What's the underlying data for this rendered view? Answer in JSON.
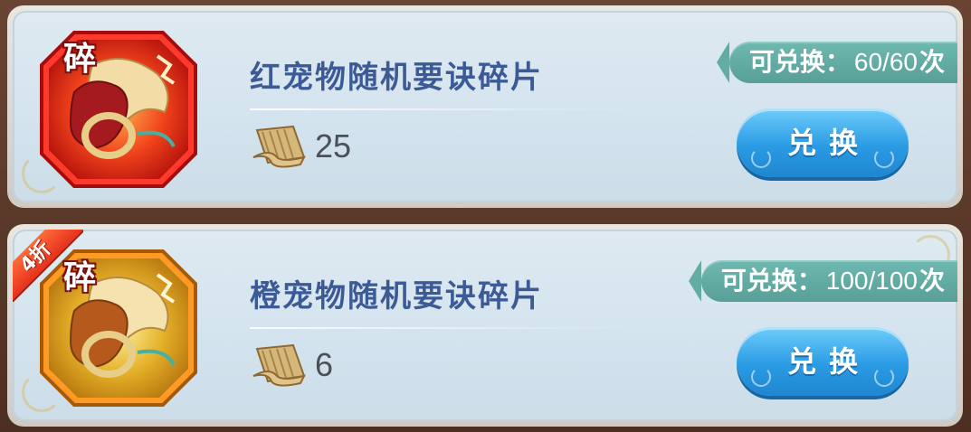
{
  "items": [
    {
      "name": "红宠物随机要诀碎片",
      "shard_label": "碎",
      "cost": "25",
      "quota_label": "可兑换：",
      "quota_count": "60/60",
      "quota_unit": "次",
      "button_label": "兑换",
      "frame_color": "#e8241c",
      "discount": null
    },
    {
      "name": "橙宠物随机要诀碎片",
      "shard_label": "碎",
      "cost": "6",
      "quota_label": "可兑换：",
      "quota_count": "100/100",
      "quota_unit": "次",
      "button_label": "兑换",
      "frame_color": "#f29a1a",
      "discount": "4折"
    }
  ],
  "icons": {
    "currency": "scroll-currency-icon",
    "item": "pet-skill-scroll-icon"
  }
}
